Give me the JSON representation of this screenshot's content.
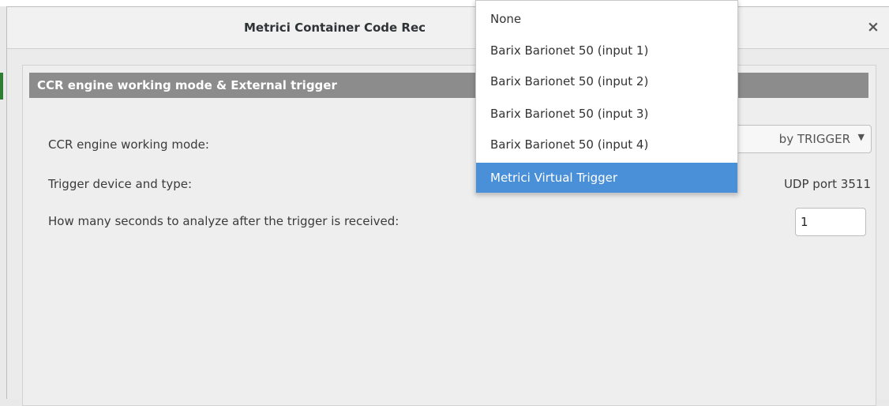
{
  "background_window": {
    "title_fragment": "Metrici Container Code Recognition settings"
  },
  "dialog": {
    "title": "Metrici Container Code Rec",
    "close_symbol": "×"
  },
  "section": {
    "title": "CCR engine working mode & External trigger"
  },
  "fields": {
    "mode_label": "CCR engine working mode:",
    "mode_value": "by TRIGGER",
    "device_label": "Trigger device and type:",
    "device_value": "UDP port 3511",
    "seconds_label": "How many seconds to analyze after the trigger is received:",
    "seconds_value": "1"
  },
  "dropdown": {
    "items": [
      "None",
      "Barix Barionet 50 (input 1)",
      "Barix Barionet 50 (input 2)",
      "Barix Barionet 50 (input 3)",
      "Barix Barionet 50 (input 4)",
      "Metrici Virtual Trigger"
    ],
    "selected_index": 5
  },
  "colors": {
    "selection": "#4a90d9",
    "section_header": "#8c8c8c",
    "accent_green": "#2e7d32"
  }
}
